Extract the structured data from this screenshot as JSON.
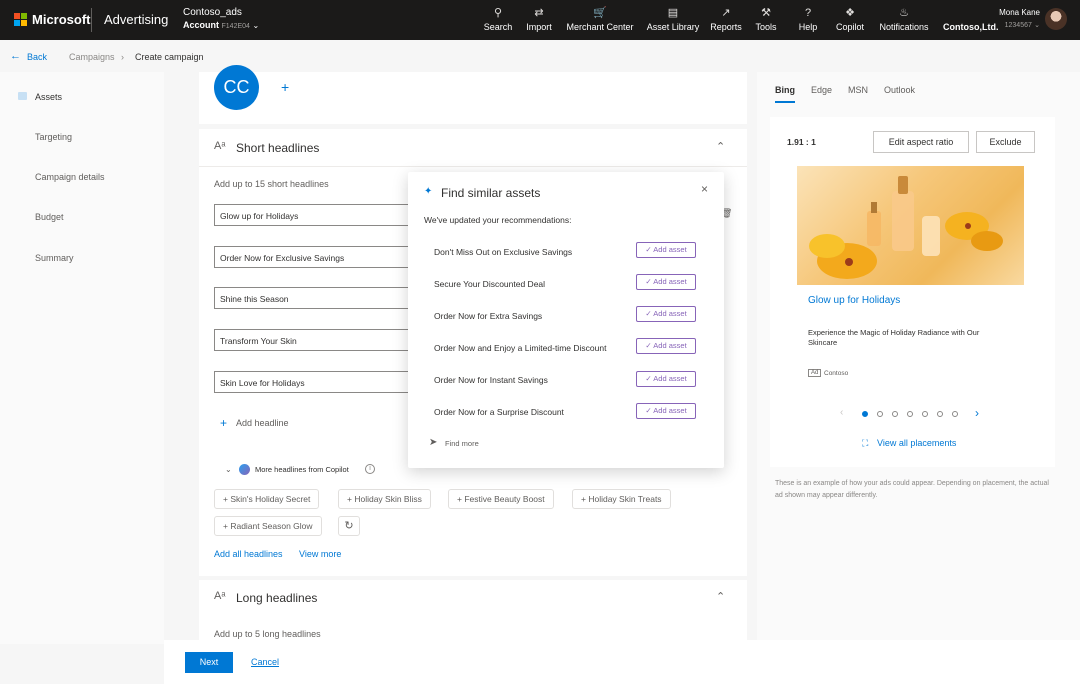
{
  "topnav": {
    "brand": "Microsoft",
    "product": "Advertising",
    "account_name": "Contoso_ads",
    "account_label": "Account",
    "account_id": "F142E04",
    "items": [
      {
        "label": "Search",
        "icon": "search-icon"
      },
      {
        "label": "Import",
        "icon": "import-icon"
      },
      {
        "label": "Merchant Center",
        "icon": "cart-icon"
      },
      {
        "label": "Asset Library",
        "icon": "library-icon"
      },
      {
        "label": "Reports",
        "icon": "chart-icon"
      },
      {
        "label": "Tools",
        "icon": "wrench-icon"
      },
      {
        "label": "Help",
        "icon": "help-icon"
      },
      {
        "label": "Copilot",
        "icon": "copilot-icon"
      },
      {
        "label": "Notifications",
        "icon": "bell-icon"
      }
    ],
    "org": "Contoso,Ltd.",
    "org_id": "1234567",
    "user_name": "Mona Kane"
  },
  "breadcrumb": {
    "back": "Back",
    "campaigns": "Campaigns",
    "current": "Create campaign"
  },
  "leftnav": [
    "Assets",
    "Targeting",
    "Campaign details",
    "Budget",
    "Summary"
  ],
  "logo_initials": "CC",
  "short_headlines": {
    "title": "Short headlines",
    "hint": "Add up to 15 short headlines",
    "values": [
      "Glow up for Holidays",
      "Order Now for Exclusive Savings",
      "Shine this Season",
      "Transform Your Skin",
      "Skin Love for Holidays"
    ],
    "add_label": "Add headline",
    "copilot_label": "More headlines from Copilot",
    "suggestions": [
      "Skin's Holiday Secret",
      "Holiday Skin Bliss",
      "Festive Beauty Boost",
      "Holiday Skin Treats",
      "Radiant Season Glow"
    ],
    "add_all": "Add all headlines",
    "view_more": "View more"
  },
  "long_headlines": {
    "title": "Long headlines",
    "hint": "Add up to 5 long headlines"
  },
  "popup": {
    "title": "Find similar assets",
    "subtitle": "We've updated your recommendations:",
    "items": [
      "Don't Miss Out on Exclusive Savings",
      "Secure Your Discounted Deal",
      "Order Now for Extra Savings",
      "Order Now and Enjoy a Limited-time Discount",
      "Order Now for Instant Savings",
      "Order Now for a Surprise Discount"
    ],
    "add_label": "Add asset",
    "find_more": "Find more"
  },
  "preview": {
    "tabs": [
      "Bing",
      "Edge",
      "MSN",
      "Outlook"
    ],
    "active_tab": "Bing",
    "ratio": "1.91 : 1",
    "edit_ratio": "Edit aspect ratio",
    "exclude": "Exclude",
    "ad_headline": "Glow up for Holidays",
    "ad_description": "Experience the Magic of Holiday Radiance with Our Skincare",
    "ad_badge": "Ad",
    "ad_brand": "Contoso",
    "carousel_total": 7,
    "carousel_active": 1,
    "view_all": "View all placements",
    "disclaimer": "These is an example of how your ads could appear. Depending on placement, the actual ad shown may appear differently."
  },
  "footer": {
    "next": "Next",
    "cancel": "Cancel"
  },
  "colors": {
    "accent": "#0078d4",
    "copilot_purple": "#8764b8",
    "topbar": "#1b1a19"
  }
}
